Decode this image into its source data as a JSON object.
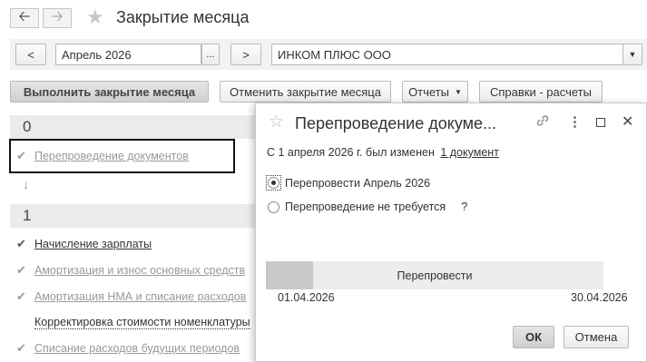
{
  "window": {
    "title": "Закрытие месяца",
    "back_icon": "arrow-left-icon",
    "forward_icon": "arrow-right-icon",
    "favorite_icon": "star-icon"
  },
  "filters": {
    "prev_label": "<",
    "period_value": "Апрель 2026",
    "period_select_label": "...",
    "next_label": ">",
    "organization_value": "ИНКОМ ПЛЮС ООО"
  },
  "toolbar": {
    "execute_label": "Выполнить закрытие месяца",
    "cancel_label": "Отменить закрытие месяца",
    "reports_label": "Отчеты",
    "help_label": "Справки - расчеты"
  },
  "steps": {
    "section0": "0",
    "repost_docs": "Перепроведение документов",
    "section1": "1",
    "payroll": "Начисление зарплаты",
    "depreciation_os": "Амортизация и износ основных средств",
    "depreciation_nma": "Амортизация НМА и списание расходов",
    "cost_adjustment": "Корректировка стоимости номенклатуры",
    "future_expenses": "Списание расходов будущих периодов"
  },
  "dialog": {
    "title": "Перепроведение докуме...",
    "changed_text": "С 1 апреля 2026 г. был изменен",
    "changed_link": "1 документ",
    "option_repost": "Перепровести Апрель 2026",
    "option_not_required": "Перепроведение не требуется",
    "help_mark": "?",
    "progress_label": "Перепровести",
    "progress_fraction": 0.14,
    "date_start": "01.04.2026",
    "date_end": "30.04.2026",
    "ok_label": "ОК",
    "cancel_label": "Отмена"
  }
}
